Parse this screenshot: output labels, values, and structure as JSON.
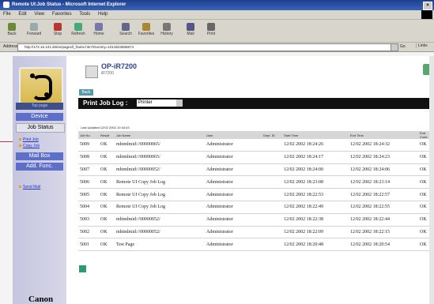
{
  "window": {
    "title": "Remote UI:Job Status - Microsoft Internet Explorer"
  },
  "menu": [
    "File",
    "Edit",
    "View",
    "Favorites",
    "Tools",
    "Help"
  ],
  "toolbar": [
    {
      "label": "Back",
      "icon": "back-arrow-icon"
    },
    {
      "label": "Forward",
      "icon": "forward-arrow-icon"
    },
    {
      "label": "Stop",
      "icon": "stop-icon"
    },
    {
      "label": "Refresh",
      "icon": "refresh-icon"
    },
    {
      "label": "Home",
      "icon": "home-icon"
    },
    {
      "label": "Search",
      "icon": "search-icon"
    },
    {
      "label": "Favorites",
      "icon": "favorites-icon"
    },
    {
      "label": "History",
      "icon": "history-icon"
    },
    {
      "label": "Mail",
      "icon": "mail-icon"
    },
    {
      "label": "Print",
      "icon": "print-icon"
    }
  ],
  "address": {
    "label": "Address",
    "url": "http://172.16.121.26/en/pages/l_frame.htm?Dummy=1013523666674",
    "go": "Go",
    "links": "Links"
  },
  "sidebar": {
    "top_page": "Top page",
    "items": [
      "Device",
      "Job Status",
      "Mail Box",
      "Add. Func."
    ],
    "sub": [
      "Print Job",
      "Copy Job",
      "Send Mail"
    ],
    "brand": "Canon"
  },
  "device": {
    "name": "OP-iR7200",
    "sub": "iR7200"
  },
  "back_label": "Back",
  "section": {
    "title": "Print Job Log :",
    "select": "Printer"
  },
  "updated": "Last Updated 12/02 2002 10:34:43",
  "table": {
    "headers": [
      "Job No.",
      "Result",
      "Job Name",
      "User",
      "Dept. ID",
      "Start Time",
      "End Time",
      "End Code"
    ],
    "rows": [
      [
        "5009",
        "OK",
        "mhtmlmid://00000065/",
        "Administrator",
        "",
        "12/02 2002 18:24:26",
        "12/02 2002 18:24:32",
        "OK"
      ],
      [
        "5008",
        "OK",
        "mhtmlmid://00000065/",
        "Administrator",
        "",
        "12/02 2002 18:24:17",
        "12/02 2002 18:24:23",
        "OK"
      ],
      [
        "5007",
        "OK",
        "mhtmlmid://00000052/",
        "Administrator",
        "",
        "12/02 2002 18:24:00",
        "12/02 2002 18:24:06",
        "OK"
      ],
      [
        "5006",
        "OK",
        "Remote UI Copy Job Log",
        "Administrator",
        "",
        "12/02 2002 18:23:08",
        "12/02 2002 18:23:14",
        "OK"
      ],
      [
        "5005",
        "OK",
        "Remote UI Copy Job Log",
        "Administrator",
        "",
        "12/02 2002 18:22:53",
        "12/02 2002 18:22:57",
        "OK"
      ],
      [
        "5004",
        "OK",
        "Remote UI Copy Job Log",
        "Administrator",
        "",
        "12/02 2002 18:22:49",
        "12/02 2002 18:22:55",
        "OK"
      ],
      [
        "5003",
        "OK",
        "mhtmlmid://00000052/",
        "Administrator",
        "",
        "12/02 2002 18:22:38",
        "12/02 2002 18:22:44",
        "OK"
      ],
      [
        "5002",
        "OK",
        "mhtmlmid://00000052/",
        "Administrator",
        "",
        "12/02 2002 18:22:09",
        "12/02 2002 18:22:15",
        "OK"
      ],
      [
        "5001",
        "OK",
        "Test Page",
        "Administrator",
        "",
        "12/02 2002 18:20:48",
        "12/02 2002 18:20:54",
        "OK"
      ]
    ]
  },
  "colors": {
    "accent": "#3e4f8a",
    "nav": "#5d6fc9",
    "brand": "#2c3f96"
  }
}
